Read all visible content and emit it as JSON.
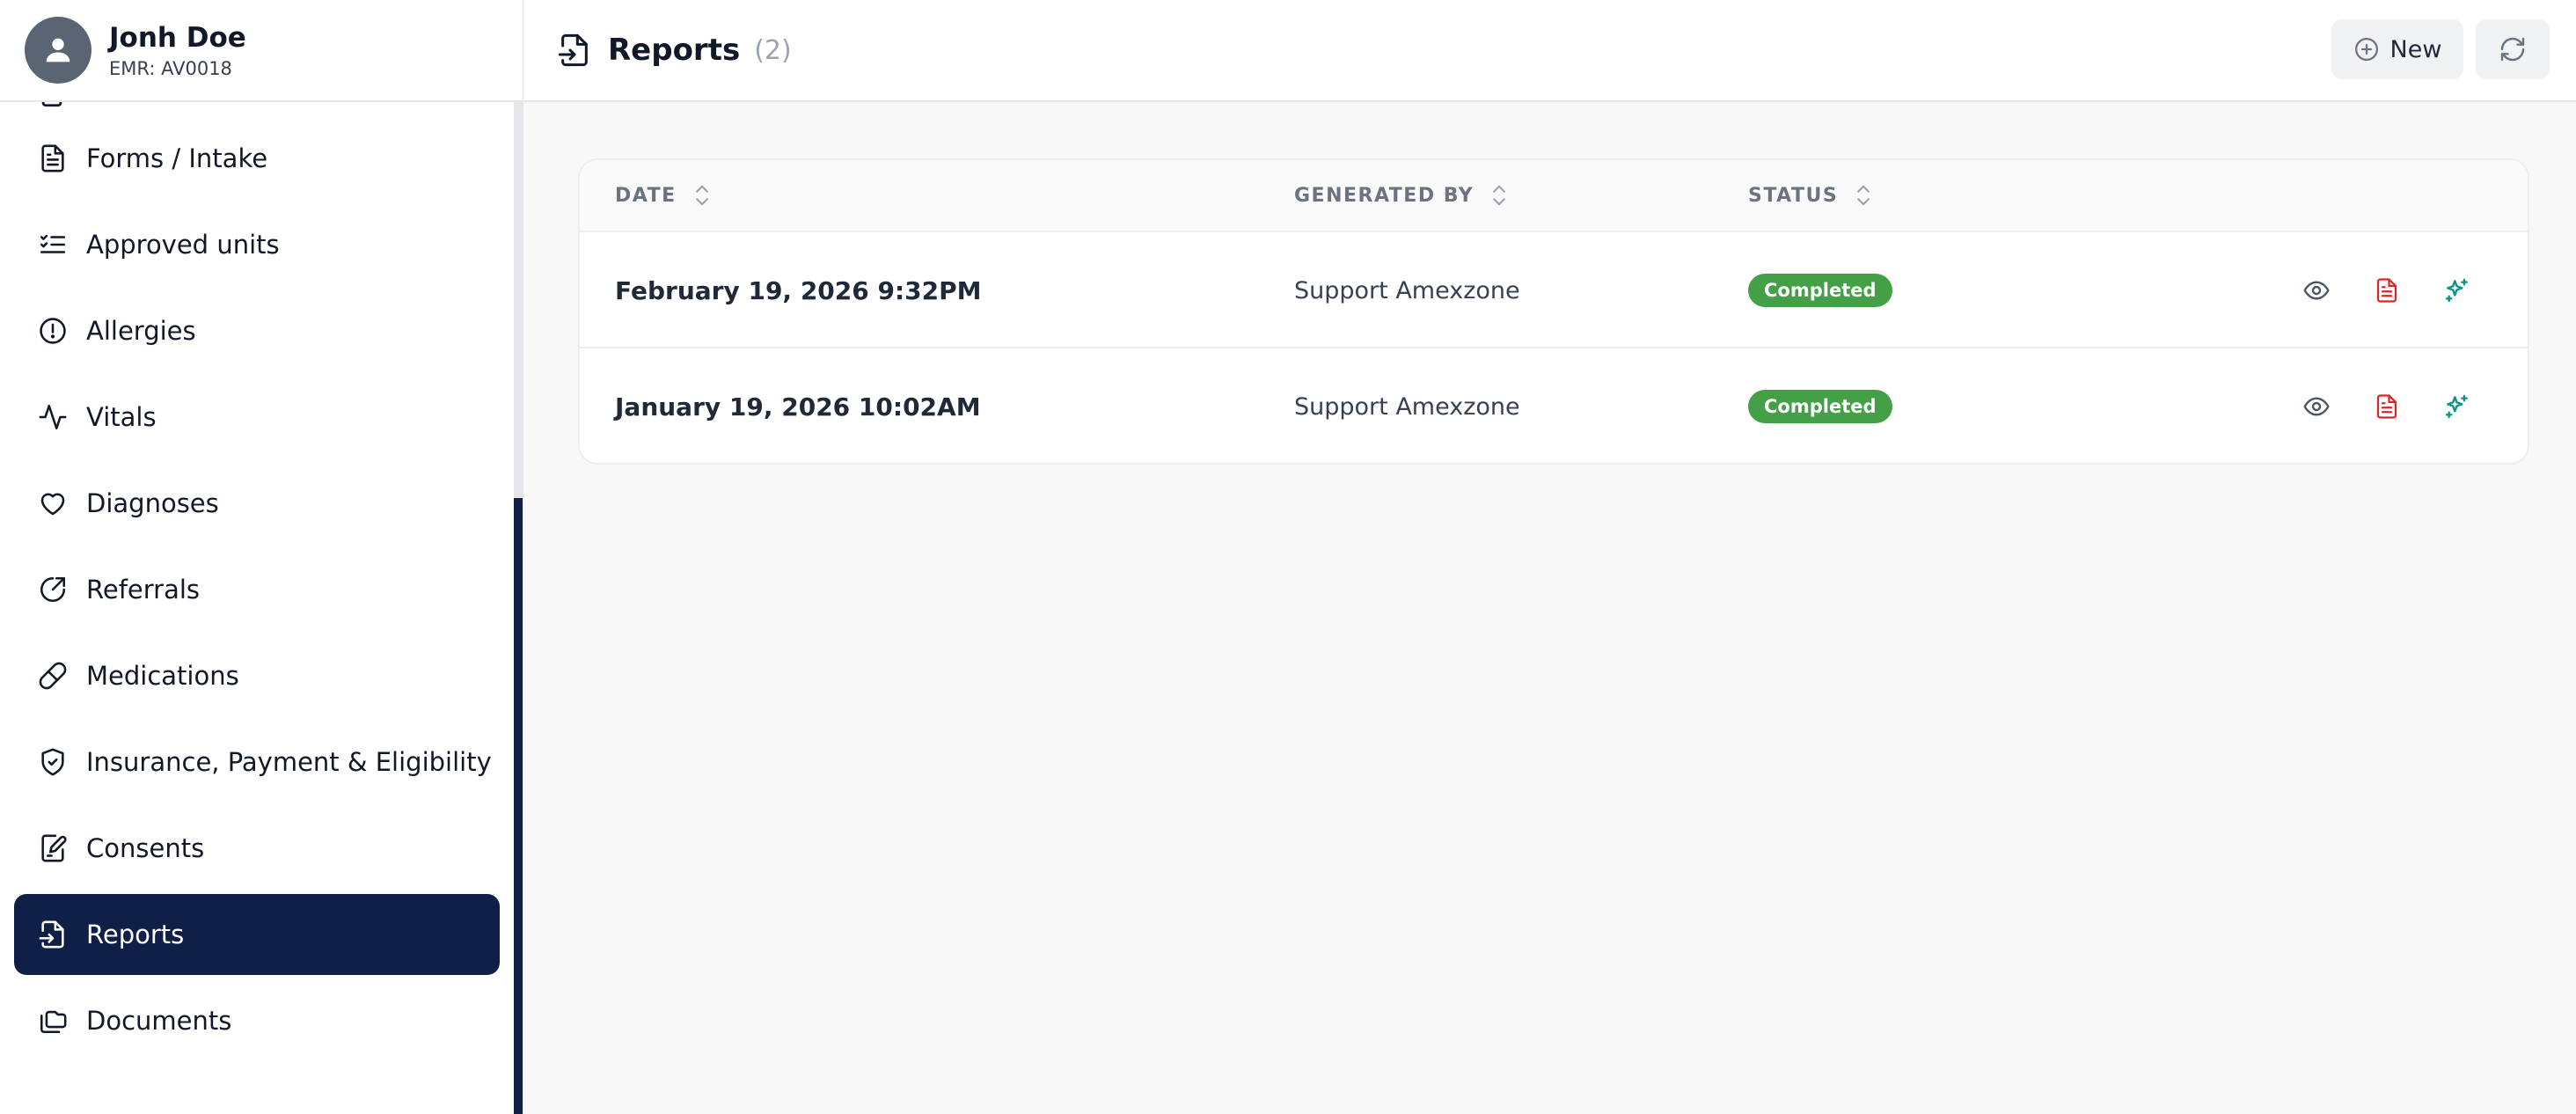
{
  "patient": {
    "name": "Jonh Doe",
    "emr": "EMR: AV0018"
  },
  "sidebar": {
    "items": [
      {
        "label": "Forms / Intake",
        "icon": "file-text-icon"
      },
      {
        "label": "Approved units",
        "icon": "list-checks-icon"
      },
      {
        "label": "Allergies",
        "icon": "alert-circle-icon"
      },
      {
        "label": "Vitals",
        "icon": "activity-icon"
      },
      {
        "label": "Diagnoses",
        "icon": "heart-icon"
      },
      {
        "label": "Referrals",
        "icon": "external-link-icon"
      },
      {
        "label": "Medications",
        "icon": "pill-icon"
      },
      {
        "label": "Insurance, Payment & Eligibility",
        "icon": "shield-check-icon"
      },
      {
        "label": "Consents",
        "icon": "file-signature-icon"
      },
      {
        "label": "Reports",
        "icon": "file-input-icon",
        "active": true
      },
      {
        "label": "Documents",
        "icon": "folders-icon"
      }
    ]
  },
  "header": {
    "title": "Reports",
    "count": "(2)",
    "new_label": "New"
  },
  "table": {
    "columns": [
      "DATE",
      "GENERATED BY",
      "STATUS"
    ],
    "rows": [
      {
        "date": "February 19, 2026 9:32PM",
        "generated_by": "Support Amexzone",
        "status": "Completed"
      },
      {
        "date": "January 19, 2026 10:02AM",
        "generated_by": "Support Amexzone",
        "status": "Completed"
      }
    ]
  },
  "colors": {
    "active_nav": "#0f1f45",
    "status_completed": "#43a047",
    "pdf_icon": "#dc2626",
    "ai_icon": "#0d9488"
  }
}
